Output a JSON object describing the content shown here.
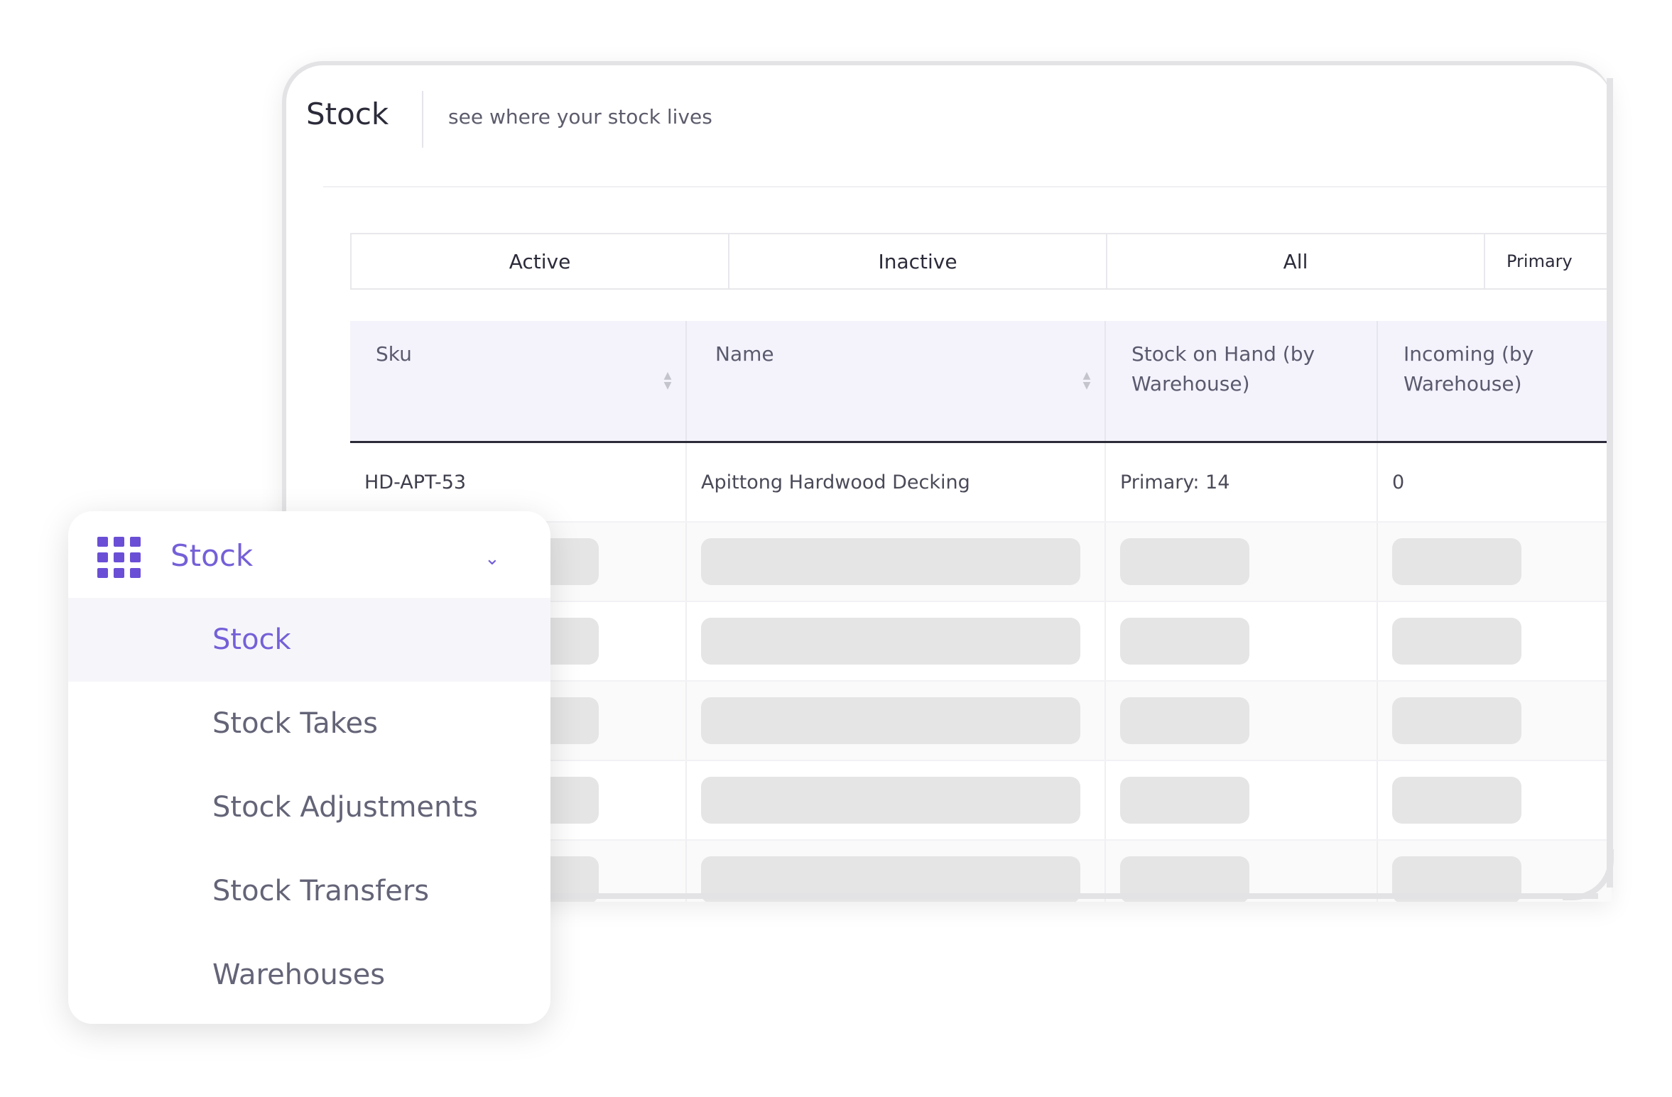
{
  "page": {
    "title": "Stock",
    "subtitle": "see where your stock lives"
  },
  "tabs": [
    {
      "label": "Active"
    },
    {
      "label": "Inactive"
    },
    {
      "label": "All"
    },
    {
      "label": "Primary"
    }
  ],
  "table": {
    "columns": [
      {
        "label": "Sku",
        "sortable": true
      },
      {
        "label": "Name",
        "sortable": true
      },
      {
        "label": "Stock on Hand (by Warehouse)",
        "sortable": false
      },
      {
        "label": "Incoming (by Warehouse)",
        "sortable": false
      }
    ],
    "rows": [
      {
        "sku": "HD-APT-53",
        "name": "Apittong Hardwood Decking",
        "stock_on_hand": "Primary: 14",
        "incoming": "0"
      }
    ],
    "loading_rows": 5
  },
  "nav": {
    "section_label": "Stock",
    "section_icon": "grid-icon",
    "expand_icon": "chevron-down-icon",
    "items": [
      {
        "label": "Stock",
        "active": true
      },
      {
        "label": "Stock Takes",
        "active": false
      },
      {
        "label": "Stock Adjustments",
        "active": false
      },
      {
        "label": "Stock Transfers",
        "active": false
      },
      {
        "label": "Warehouses",
        "active": false
      }
    ]
  },
  "colors": {
    "accent": "#7560d8",
    "header_bg": "#f4f3fc",
    "skeleton": "#e5e5e5"
  }
}
